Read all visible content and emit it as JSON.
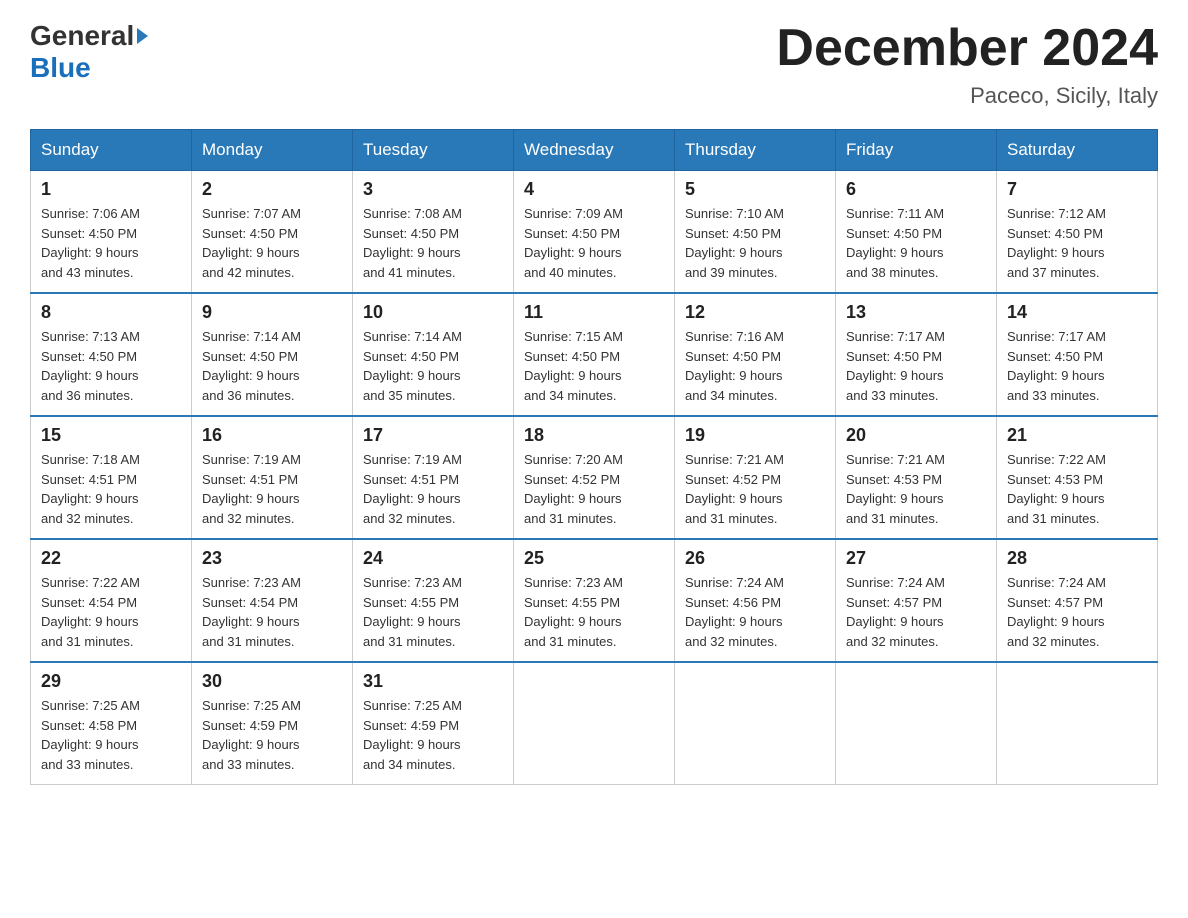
{
  "header": {
    "logo_general": "General",
    "logo_blue": "Blue",
    "title": "December 2024",
    "subtitle": "Paceco, Sicily, Italy"
  },
  "days_of_week": [
    "Sunday",
    "Monday",
    "Tuesday",
    "Wednesday",
    "Thursday",
    "Friday",
    "Saturday"
  ],
  "weeks": [
    [
      {
        "day": "1",
        "sunrise": "7:06 AM",
        "sunset": "4:50 PM",
        "daylight": "9 hours and 43 minutes."
      },
      {
        "day": "2",
        "sunrise": "7:07 AM",
        "sunset": "4:50 PM",
        "daylight": "9 hours and 42 minutes."
      },
      {
        "day": "3",
        "sunrise": "7:08 AM",
        "sunset": "4:50 PM",
        "daylight": "9 hours and 41 minutes."
      },
      {
        "day": "4",
        "sunrise": "7:09 AM",
        "sunset": "4:50 PM",
        "daylight": "9 hours and 40 minutes."
      },
      {
        "day": "5",
        "sunrise": "7:10 AM",
        "sunset": "4:50 PM",
        "daylight": "9 hours and 39 minutes."
      },
      {
        "day": "6",
        "sunrise": "7:11 AM",
        "sunset": "4:50 PM",
        "daylight": "9 hours and 38 minutes."
      },
      {
        "day": "7",
        "sunrise": "7:12 AM",
        "sunset": "4:50 PM",
        "daylight": "9 hours and 37 minutes."
      }
    ],
    [
      {
        "day": "8",
        "sunrise": "7:13 AM",
        "sunset": "4:50 PM",
        "daylight": "9 hours and 36 minutes."
      },
      {
        "day": "9",
        "sunrise": "7:14 AM",
        "sunset": "4:50 PM",
        "daylight": "9 hours and 36 minutes."
      },
      {
        "day": "10",
        "sunrise": "7:14 AM",
        "sunset": "4:50 PM",
        "daylight": "9 hours and 35 minutes."
      },
      {
        "day": "11",
        "sunrise": "7:15 AM",
        "sunset": "4:50 PM",
        "daylight": "9 hours and 34 minutes."
      },
      {
        "day": "12",
        "sunrise": "7:16 AM",
        "sunset": "4:50 PM",
        "daylight": "9 hours and 34 minutes."
      },
      {
        "day": "13",
        "sunrise": "7:17 AM",
        "sunset": "4:50 PM",
        "daylight": "9 hours and 33 minutes."
      },
      {
        "day": "14",
        "sunrise": "7:17 AM",
        "sunset": "4:50 PM",
        "daylight": "9 hours and 33 minutes."
      }
    ],
    [
      {
        "day": "15",
        "sunrise": "7:18 AM",
        "sunset": "4:51 PM",
        "daylight": "9 hours and 32 minutes."
      },
      {
        "day": "16",
        "sunrise": "7:19 AM",
        "sunset": "4:51 PM",
        "daylight": "9 hours and 32 minutes."
      },
      {
        "day": "17",
        "sunrise": "7:19 AM",
        "sunset": "4:51 PM",
        "daylight": "9 hours and 32 minutes."
      },
      {
        "day": "18",
        "sunrise": "7:20 AM",
        "sunset": "4:52 PM",
        "daylight": "9 hours and 31 minutes."
      },
      {
        "day": "19",
        "sunrise": "7:21 AM",
        "sunset": "4:52 PM",
        "daylight": "9 hours and 31 minutes."
      },
      {
        "day": "20",
        "sunrise": "7:21 AM",
        "sunset": "4:53 PM",
        "daylight": "9 hours and 31 minutes."
      },
      {
        "day": "21",
        "sunrise": "7:22 AM",
        "sunset": "4:53 PM",
        "daylight": "9 hours and 31 minutes."
      }
    ],
    [
      {
        "day": "22",
        "sunrise": "7:22 AM",
        "sunset": "4:54 PM",
        "daylight": "9 hours and 31 minutes."
      },
      {
        "day": "23",
        "sunrise": "7:23 AM",
        "sunset": "4:54 PM",
        "daylight": "9 hours and 31 minutes."
      },
      {
        "day": "24",
        "sunrise": "7:23 AM",
        "sunset": "4:55 PM",
        "daylight": "9 hours and 31 minutes."
      },
      {
        "day": "25",
        "sunrise": "7:23 AM",
        "sunset": "4:55 PM",
        "daylight": "9 hours and 31 minutes."
      },
      {
        "day": "26",
        "sunrise": "7:24 AM",
        "sunset": "4:56 PM",
        "daylight": "9 hours and 32 minutes."
      },
      {
        "day": "27",
        "sunrise": "7:24 AM",
        "sunset": "4:57 PM",
        "daylight": "9 hours and 32 minutes."
      },
      {
        "day": "28",
        "sunrise": "7:24 AM",
        "sunset": "4:57 PM",
        "daylight": "9 hours and 32 minutes."
      }
    ],
    [
      {
        "day": "29",
        "sunrise": "7:25 AM",
        "sunset": "4:58 PM",
        "daylight": "9 hours and 33 minutes."
      },
      {
        "day": "30",
        "sunrise": "7:25 AM",
        "sunset": "4:59 PM",
        "daylight": "9 hours and 33 minutes."
      },
      {
        "day": "31",
        "sunrise": "7:25 AM",
        "sunset": "4:59 PM",
        "daylight": "9 hours and 34 minutes."
      },
      null,
      null,
      null,
      null
    ]
  ],
  "labels": {
    "sunrise": "Sunrise:",
    "sunset": "Sunset:",
    "daylight": "Daylight:"
  }
}
